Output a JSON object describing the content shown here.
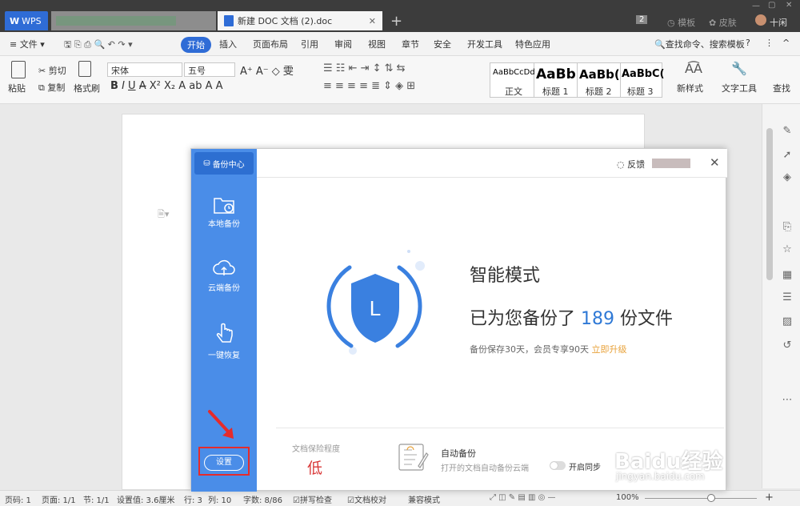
{
  "titlebar": {
    "app_tab": "WPS",
    "doc_tab": "新建 DOC 文档 (2).doc",
    "badge": "2",
    "template": "模板",
    "skin": "皮肤",
    "user": "十闲"
  },
  "menubar": {
    "file": "文件",
    "items": [
      "开始",
      "插入",
      "页面布局",
      "引用",
      "审阅",
      "视图",
      "章节",
      "安全",
      "开发工具",
      "特色应用"
    ],
    "search": "查找命令、搜索模板"
  },
  "ribbon": {
    "cut": "剪切",
    "copy": "复制",
    "paste": "粘贴",
    "format_painter": "格式刷",
    "font": "宋体",
    "size": "五号",
    "styles": [
      {
        "sample": "AaBbCcDd",
        "name": "正文"
      },
      {
        "sample": "AaBb",
        "name": "标题 1"
      },
      {
        "sample": "AaBb(",
        "name": "标题 2"
      },
      {
        "sample": "AaBbC(",
        "name": "标题 3"
      }
    ],
    "new_style": "新样式",
    "text_tools": "文字工具",
    "find": "查找"
  },
  "dialog": {
    "header": "备份中心",
    "sidebar": [
      {
        "label": "本地备份",
        "icon": "folder-clock-icon"
      },
      {
        "label": "云端备份",
        "icon": "cloud-upload-icon"
      },
      {
        "label": "一键恢复",
        "icon": "hand-pointer-icon"
      }
    ],
    "settings": "设置",
    "feedback": "反馈",
    "mode": "智能模式",
    "backup_prefix": "已为您备份了",
    "backup_count": "189",
    "backup_suffix": "份文件",
    "retention": "备份保存30天，会员专享90天",
    "upgrade": "立即升级",
    "protection_label": "文档保险程度",
    "protection_value": "低",
    "autobackup_title": "自动备份",
    "autobackup_desc": "打开的文档自动备份云端",
    "sync_label": "开启同步",
    "shield_letter": "L"
  },
  "statusbar": {
    "page_no": "页码: 1",
    "pages": "页面: 1/1",
    "section": "节: 1/1",
    "setting": "设置值: 3.6厘米",
    "row": "行: 3",
    "col": "列: 10",
    "words": "字数: 8/86",
    "spell": "拼写检查",
    "proof": "文档校对",
    "compat": "兼容模式",
    "zoom": "100%"
  },
  "watermark": {
    "main": "Baidu经验",
    "sub": "jingyan.baidu.com"
  },
  "colors": {
    "accent": "#2f6cd6",
    "sidebar": "#4a8de8",
    "highlight": "#e52b2b",
    "upgrade": "#e8a23a"
  }
}
